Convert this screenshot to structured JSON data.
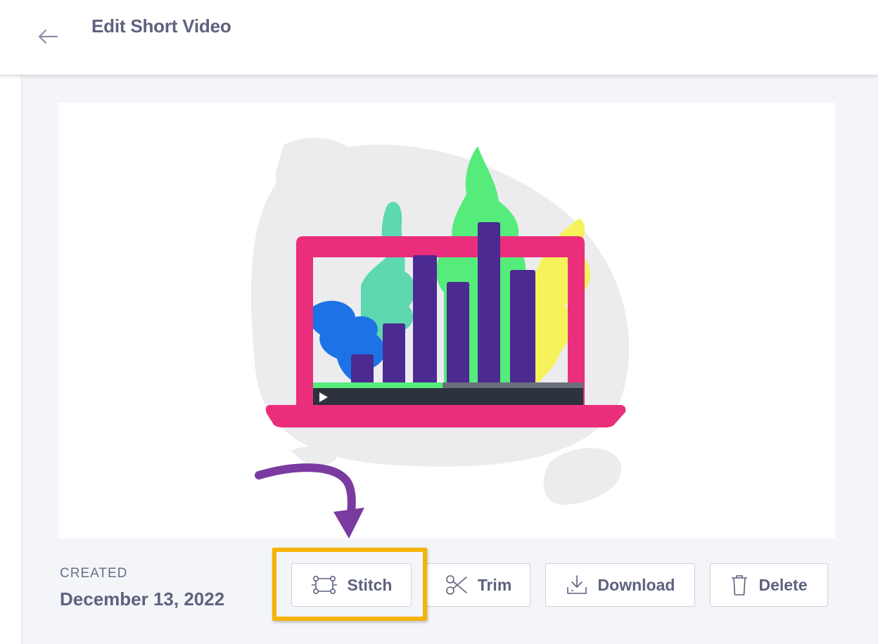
{
  "header": {
    "title": "Edit Short Video",
    "back_icon": "arrow-left-icon"
  },
  "thumbnail": {
    "colors": {
      "blob": "#ececef",
      "laptop": "#ea2e7c",
      "bars": "#4b2a91",
      "leaf_green": "#56ec7b",
      "leaf_teal": "#5dd8b0",
      "leaf_blue": "#1d72e6",
      "leaf_yellow": "#f6f25b",
      "control_bar": "#2c323e",
      "progress": "#56ec7b"
    },
    "progress": 0.48,
    "play_icon": "play-icon"
  },
  "meta": {
    "created_label": "CREATED",
    "created_date": "December 13, 2022"
  },
  "actions": {
    "stitch": {
      "label": "Stitch",
      "icon": "stitch-icon"
    },
    "trim": {
      "label": "Trim",
      "icon": "scissors-icon"
    },
    "download": {
      "label": "Download",
      "icon": "download-icon"
    },
    "delete": {
      "label": "Delete",
      "icon": "trash-icon"
    }
  },
  "annotation": {
    "highlight_color": "#f5b400",
    "arrow_color": "#7a3aa0"
  }
}
